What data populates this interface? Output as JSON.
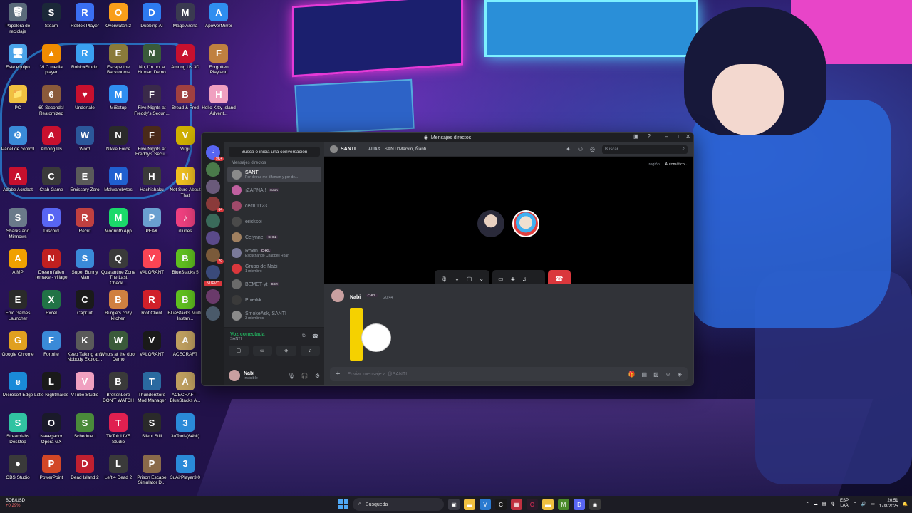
{
  "desktop": {
    "icons": [
      {
        "label": "Papelera de reciclaje",
        "icon": "recycle-bin-icon",
        "color": "#5a6b7a",
        "glyph": "🗑",
        "col": 0,
        "row": 0
      },
      {
        "label": "Steam",
        "icon": "steam-icon",
        "color": "#1b2838",
        "glyph": "S",
        "col": 1,
        "row": 0
      },
      {
        "label": "Roblox Player",
        "icon": "roblox-icon",
        "color": "#3a6ff2",
        "glyph": "R",
        "col": 2,
        "row": 0
      },
      {
        "label": "Overwatch 2",
        "icon": "overwatch-icon",
        "color": "#f99e1a",
        "glyph": "O",
        "col": 3,
        "row": 0
      },
      {
        "label": "Dubbing AI",
        "icon": "dubbing-ai-icon",
        "color": "#2e7bf0",
        "glyph": "D",
        "col": 4,
        "row": 0
      },
      {
        "label": "Mage Arena",
        "icon": "mage-arena-icon",
        "color": "#3a3a50",
        "glyph": "M",
        "col": 5,
        "row": 0
      },
      {
        "label": "ApowerMirror",
        "icon": "apowermirror-icon",
        "color": "#2f8ef0",
        "glyph": "A",
        "col": 6,
        "row": 0
      },
      {
        "label": "Este equipo",
        "icon": "computer-icon",
        "color": "#4aa3e8",
        "glyph": "🖥",
        "col": 0,
        "row": 1
      },
      {
        "label": "VLC media player",
        "icon": "vlc-icon",
        "color": "#f08b00",
        "glyph": "▲",
        "col": 1,
        "row": 1
      },
      {
        "label": "RobloxStudio",
        "icon": "roblox-studio-icon",
        "color": "#3aa0f0",
        "glyph": "R",
        "col": 2,
        "row": 1
      },
      {
        "label": "Escape the Backrooms",
        "icon": "backrooms-icon",
        "color": "#8a7a3a",
        "glyph": "E",
        "col": 3,
        "row": 1
      },
      {
        "label": "No, I'm not a Human Demo",
        "icon": "not-human-icon",
        "color": "#3a5a3a",
        "glyph": "N",
        "col": 4,
        "row": 1
      },
      {
        "label": "Among Us 3D",
        "icon": "among-us-icon",
        "color": "#c8102e",
        "glyph": "A",
        "col": 5,
        "row": 1
      },
      {
        "label": "Forgotten Playland",
        "icon": "forgotten-playland-icon",
        "color": "#c08040",
        "glyph": "F",
        "col": 6,
        "row": 1
      },
      {
        "label": "PC",
        "icon": "folder-icon",
        "color": "#f0c040",
        "glyph": "📁",
        "col": 0,
        "row": 2
      },
      {
        "label": "60 Seconds! Reatomized",
        "icon": "sixty-seconds-icon",
        "color": "#8a5a3a",
        "glyph": "6",
        "col": 1,
        "row": 2
      },
      {
        "label": "Undertale",
        "icon": "undertale-icon",
        "color": "#c8102e",
        "glyph": "♥",
        "col": 2,
        "row": 2
      },
      {
        "label": "MiSetup",
        "icon": "misetup-icon",
        "color": "#2f8ef0",
        "glyph": "M",
        "col": 3,
        "row": 2
      },
      {
        "label": "Five Nights at Freddy's Securi...",
        "icon": "fnaf-security-icon",
        "color": "#3a2a4a",
        "glyph": "F",
        "col": 4,
        "row": 2
      },
      {
        "label": "Bread & Fred",
        "icon": "bread-fred-icon",
        "color": "#a04040",
        "glyph": "B",
        "col": 5,
        "row": 2
      },
      {
        "label": "Hello Kitty Island Advent...",
        "icon": "hello-kitty-icon",
        "color": "#f0a0c0",
        "glyph": "H",
        "col": 6,
        "row": 2
      },
      {
        "label": "Panel de control",
        "icon": "control-panel-icon",
        "color": "#3a8ad8",
        "glyph": "⚙",
        "col": 0,
        "row": 3
      },
      {
        "label": "Among Us",
        "icon": "among-us-icon",
        "color": "#c8102e",
        "glyph": "A",
        "col": 1,
        "row": 3
      },
      {
        "label": "Word",
        "icon": "word-icon",
        "color": "#2b579a",
        "glyph": "W",
        "col": 2,
        "row": 3
      },
      {
        "label": "Nikke Force",
        "icon": "nikke-icon",
        "color": "#2a2a2a",
        "glyph": "N",
        "col": 3,
        "row": 3
      },
      {
        "label": "Five Nights at Freddy's Secu...",
        "icon": "fnaf-icon",
        "color": "#4a2a1a",
        "glyph": "F",
        "col": 4,
        "row": 3
      },
      {
        "label": "Virgil",
        "icon": "virgil-icon",
        "color": "#d0b000",
        "glyph": "V",
        "col": 5,
        "row": 3
      },
      {
        "label": "Adobe Acrobat",
        "icon": "acrobat-icon",
        "color": "#c8102e",
        "glyph": "A",
        "col": 0,
        "row": 4
      },
      {
        "label": "Crab Game",
        "icon": "crab-game-icon",
        "color": "#3a3a3a",
        "glyph": "C",
        "col": 1,
        "row": 4
      },
      {
        "label": "Emissary Zero",
        "icon": "emissary-zero-icon",
        "color": "#5a5a5a",
        "glyph": "E",
        "col": 2,
        "row": 4
      },
      {
        "label": "Malwarebytes",
        "icon": "malwarebytes-icon",
        "color": "#2060d0",
        "glyph": "M",
        "col": 3,
        "row": 4
      },
      {
        "label": "Hachishaku",
        "icon": "hachishaku-icon",
        "color": "#3a3a3a",
        "glyph": "H",
        "col": 4,
        "row": 4
      },
      {
        "label": "Not Sure About That",
        "icon": "not-sure-icon",
        "color": "#f0c020",
        "glyph": "N",
        "col": 5,
        "row": 4
      },
      {
        "label": "Sharks and Minnows",
        "icon": "sharks-icon",
        "color": "#6a7a8a",
        "glyph": "S",
        "col": 0,
        "row": 5
      },
      {
        "label": "Discord",
        "icon": "discord-icon",
        "color": "#5865f2",
        "glyph": "D",
        "col": 1,
        "row": 5
      },
      {
        "label": "Recut",
        "icon": "recut-icon",
        "color": "#c04040",
        "glyph": "R",
        "col": 2,
        "row": 5
      },
      {
        "label": "Modrinth App",
        "icon": "modrinth-icon",
        "color": "#1bd96a",
        "glyph": "M",
        "col": 3,
        "row": 5
      },
      {
        "label": "PEAK",
        "icon": "peak-icon",
        "color": "#6aa0d0",
        "glyph": "P",
        "col": 4,
        "row": 5
      },
      {
        "label": "iTunes",
        "icon": "itunes-icon",
        "color": "#f04080",
        "glyph": "♪",
        "col": 5,
        "row": 5
      },
      {
        "label": "AIMP",
        "icon": "aimp-icon",
        "color": "#f0a000",
        "glyph": "A",
        "col": 0,
        "row": 6
      },
      {
        "label": "Dream fallen remake - village",
        "icon": "dream-fallen-icon",
        "color": "#c02020",
        "glyph": "N",
        "col": 1,
        "row": 6
      },
      {
        "label": "Super Bunny Man",
        "icon": "bunny-man-icon",
        "color": "#3a8ad8",
        "glyph": "S",
        "col": 2,
        "row": 6
      },
      {
        "label": "Quarantine Zone The Last Check...",
        "icon": "quarantine-icon",
        "color": "#3a3a3a",
        "glyph": "Q",
        "col": 3,
        "row": 6
      },
      {
        "label": "VALORANT",
        "icon": "valorant-icon",
        "color": "#fa4454",
        "glyph": "V",
        "col": 4,
        "row": 6
      },
      {
        "label": "BlueStacks 5",
        "icon": "bluestacks-icon",
        "color": "#60c020",
        "glyph": "B",
        "col": 5,
        "row": 6
      },
      {
        "label": "Epic Games Launcher",
        "icon": "epic-games-icon",
        "color": "#2a2a2a",
        "glyph": "E",
        "col": 0,
        "row": 7
      },
      {
        "label": "Excel",
        "icon": "excel-icon",
        "color": "#217346",
        "glyph": "X",
        "col": 1,
        "row": 7
      },
      {
        "label": "CapCut",
        "icon": "capcut-icon",
        "color": "#1a1a1a",
        "glyph": "C",
        "col": 2,
        "row": 7
      },
      {
        "label": "Burgie's cozy kitchen",
        "icon": "burgie-icon",
        "color": "#d08040",
        "glyph": "B",
        "col": 3,
        "row": 7
      },
      {
        "label": "Riot Client",
        "icon": "riot-client-icon",
        "color": "#d0202a",
        "glyph": "R",
        "col": 4,
        "row": 7
      },
      {
        "label": "BlueStacks Multi-Instan...",
        "icon": "bluestacks-multi-icon",
        "color": "#60c020",
        "glyph": "B",
        "col": 5,
        "row": 7
      },
      {
        "label": "Google Chrome",
        "icon": "chrome-icon",
        "color": "#e0a020",
        "glyph": "G",
        "col": 0,
        "row": 8
      },
      {
        "label": "Fortnite",
        "icon": "fortnite-icon",
        "color": "#3a8ad8",
        "glyph": "F",
        "col": 1,
        "row": 8
      },
      {
        "label": "Keep Talking and Nobody Explod...",
        "icon": "keep-talking-icon",
        "color": "#5a5a5a",
        "glyph": "K",
        "col": 2,
        "row": 8
      },
      {
        "label": "Who's at the door Demo",
        "icon": "whos-at-door-icon",
        "color": "#3a5a3a",
        "glyph": "W",
        "col": 3,
        "row": 8
      },
      {
        "label": "VALORANT",
        "icon": "valorant-icon",
        "color": "#1a1a1a",
        "glyph": "V",
        "col": 4,
        "row": 8
      },
      {
        "label": "ACECRAFT",
        "icon": "acecraft-icon",
        "color": "#c0a060",
        "glyph": "A",
        "col": 5,
        "row": 8
      },
      {
        "label": "Microsoft Edge",
        "icon": "edge-icon",
        "color": "#1a8ad8",
        "glyph": "e",
        "col": 0,
        "row": 9
      },
      {
        "label": "Little Nightmares",
        "icon": "little-nightmares-icon",
        "color": "#1a1a1a",
        "glyph": "L",
        "col": 1,
        "row": 9
      },
      {
        "label": "VTube Studio",
        "icon": "vtube-studio-icon",
        "color": "#f0a0c0",
        "glyph": "V",
        "col": 2,
        "row": 9
      },
      {
        "label": "BrokenLore DON'T WATCH",
        "icon": "brokenlore-icon",
        "color": "#3a3a3a",
        "glyph": "B",
        "col": 3,
        "row": 9
      },
      {
        "label": "Thunderstore Mod Manager",
        "icon": "thunderstore-icon",
        "color": "#2a6aa0",
        "glyph": "T",
        "col": 4,
        "row": 9
      },
      {
        "label": "ACECRAFT - BlueStacks A...",
        "icon": "acecraft-bs-icon",
        "color": "#c0a060",
        "glyph": "A",
        "col": 5,
        "row": 9
      },
      {
        "label": "Streamlabs Desktop",
        "icon": "streamlabs-icon",
        "color": "#31c3a2",
        "glyph": "S",
        "col": 0,
        "row": 10
      },
      {
        "label": "Navegador Opera GX",
        "icon": "opera-gx-icon",
        "color": "#1a1a2a",
        "glyph": "O",
        "col": 1,
        "row": 10
      },
      {
        "label": "Schedule I",
        "icon": "schedule-icon",
        "color": "#4a8a3a",
        "glyph": "S",
        "col": 2,
        "row": 10
      },
      {
        "label": "TikTok LIVE Studio",
        "icon": "tiktok-live-icon",
        "color": "#e02050",
        "glyph": "T",
        "col": 3,
        "row": 10
      },
      {
        "label": "Silent Still",
        "icon": "silent-still-icon",
        "color": "#2a2a2a",
        "glyph": "S",
        "col": 4,
        "row": 10
      },
      {
        "label": "3uTools(64bit)",
        "icon": "3utools-icon",
        "color": "#2a8ad8",
        "glyph": "3",
        "col": 5,
        "row": 10
      },
      {
        "label": "OBS Studio",
        "icon": "obs-icon",
        "color": "#3a3a3a",
        "glyph": "●",
        "col": 0,
        "row": 11
      },
      {
        "label": "PowerPoint",
        "icon": "powerpoint-icon",
        "color": "#d24726",
        "glyph": "P",
        "col": 1,
        "row": 11
      },
      {
        "label": "Dead Island 2",
        "icon": "dead-island-icon",
        "color": "#c02030",
        "glyph": "D",
        "col": 2,
        "row": 11
      },
      {
        "label": "Left 4 Dead 2",
        "icon": "left4dead-icon",
        "color": "#3a3a3a",
        "glyph": "L",
        "col": 3,
        "row": 11
      },
      {
        "label": "Prison Escape Simulator D...",
        "icon": "prison-escape-icon",
        "color": "#8a6a4a",
        "glyph": "P",
        "col": 4,
        "row": 11
      },
      {
        "label": "3uAirPlayer3.0",
        "icon": "3uairplayer-icon",
        "color": "#2a8ad8",
        "glyph": "3",
        "col": 5,
        "row": 11
      }
    ]
  },
  "discord": {
    "window_title": "Mensajes directos",
    "servers": [
      {
        "icon": "discord-home-icon",
        "color": "#5865f2",
        "glyph": "D",
        "badge": "9K+"
      },
      {
        "icon": "server-icon",
        "color": "#4a7a4a",
        "glyph": "",
        "badge": ""
      },
      {
        "icon": "server-icon",
        "color": "#6a5a7a",
        "glyph": "",
        "badge": ""
      },
      {
        "icon": "server-icon",
        "color": "#8a3a3a",
        "glyph": "",
        "badge": "64"
      },
      {
        "icon": "server-icon",
        "color": "#3a6a5a",
        "glyph": "",
        "badge": ""
      },
      {
        "icon": "server-icon",
        "color": "#5a4a8a",
        "glyph": "",
        "badge": ""
      },
      {
        "icon": "server-icon",
        "color": "#7a5a3a",
        "glyph": "",
        "badge": "70"
      },
      {
        "icon": "server-icon",
        "color": "#3a4a7a",
        "glyph": "",
        "badge": ""
      },
      {
        "icon": "server-icon",
        "color": "#6a3a6a",
        "glyph": "",
        "badge": ""
      },
      {
        "icon": "server-icon",
        "color": "#4a5a6a",
        "glyph": "",
        "badge": ""
      }
    ],
    "nuevo_label": "NUEVO",
    "search_conversation": "Busca o inicia una conversación",
    "dm_header": "Mensajes directos",
    "dms": [
      {
        "name": "SANTI",
        "sub": "Por detras me difaman y por de...",
        "tag": "",
        "color": "#8a8a8a",
        "active": true
      },
      {
        "name": "¡ZAPNA!!",
        "sub": "",
        "tag": "moon",
        "color": "#c060a0",
        "active": false
      },
      {
        "name": "cecil.1123",
        "sub": "",
        "tag": "",
        "color": "#a04a6a",
        "active": false
      },
      {
        "name": "ericksoi",
        "sub": "",
        "tag": "",
        "color": "#4a4a4a",
        "active": false
      },
      {
        "name": "Celynnei",
        "sub": "",
        "tag": "CHKL",
        "color": "#a08060",
        "active": false
      },
      {
        "name": "Roxin",
        "sub": "Escuchando Chappell Roan",
        "tag": "CHKL",
        "color": "#7a7a9a",
        "active": false
      },
      {
        "name": "Grupo de Nabi",
        "sub": "1 miembro",
        "tag": "",
        "color": "#da373c",
        "active": false
      },
      {
        "name": "BEMET-yt",
        "sub": "",
        "tag": "SSR",
        "color": "#6a6a6a",
        "active": false
      },
      {
        "name": "Pixerkk",
        "sub": "",
        "tag": "",
        "color": "#3a3a3a",
        "active": false
      },
      {
        "name": "SmokeAsk, SANTI",
        "sub": "3 miembros",
        "tag": "",
        "color": "#8a8a8a",
        "active": false
      }
    ],
    "voice": {
      "title": "Voz conectada",
      "sub": "SANTI"
    },
    "user": {
      "name": "Nabi",
      "status": "Invisible"
    },
    "header": {
      "name": "SANTI",
      "alias_label": "ALIAS",
      "alias": "SANTI'Marvin, Ñanti",
      "search_placeholder": "Buscar"
    },
    "call": {
      "region_label": "región",
      "region_value": "Automático"
    },
    "message": {
      "author": "Nabi",
      "tag": "CHKL",
      "time": "20:44"
    },
    "composer_placeholder": "Enviar mensaje a @SANTI"
  },
  "taskbar": {
    "stock_symbol": "BOB/USD",
    "stock_change": "+0,29%",
    "search_label": "Búsqueda",
    "lang_top": "ESP",
    "lang_bottom": "LAA",
    "time": "20:51",
    "date": "17/8/2025"
  }
}
